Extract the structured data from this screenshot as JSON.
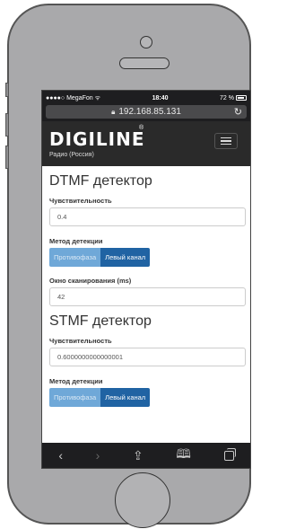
{
  "statusbar": {
    "carrier": "●●●●○ MegaFon",
    "wifi": "ᯤ",
    "time": "18:40",
    "battery_percent": "72 %"
  },
  "browser": {
    "url": "192.168.85.131"
  },
  "header": {
    "logo": "DIGILINE",
    "logo_reg": "®",
    "subtitle": "Радио (Россия)"
  },
  "dtmf": {
    "title": "DTMF детектор",
    "sensitivity_label": "Чувствительность",
    "sensitivity_value": "0.4",
    "method_label": "Метод детекции",
    "method_option_1": "Противофаза",
    "method_option_2": "Левый канал",
    "scan_window_label": "Окно сканирования (ms)",
    "scan_window_value": "42"
  },
  "stmf": {
    "title": "STMF детектор",
    "sensitivity_label": "Чувствительность",
    "sensitivity_value": "0.6000000000000001",
    "method_label": "Метод детекции",
    "method_option_1": "Противофаза",
    "method_option_2": "Левый канал"
  },
  "colors": {
    "navbar": "#2a2a2a",
    "button_active": "#2063a3",
    "button_inactive": "#6fa8d8"
  }
}
